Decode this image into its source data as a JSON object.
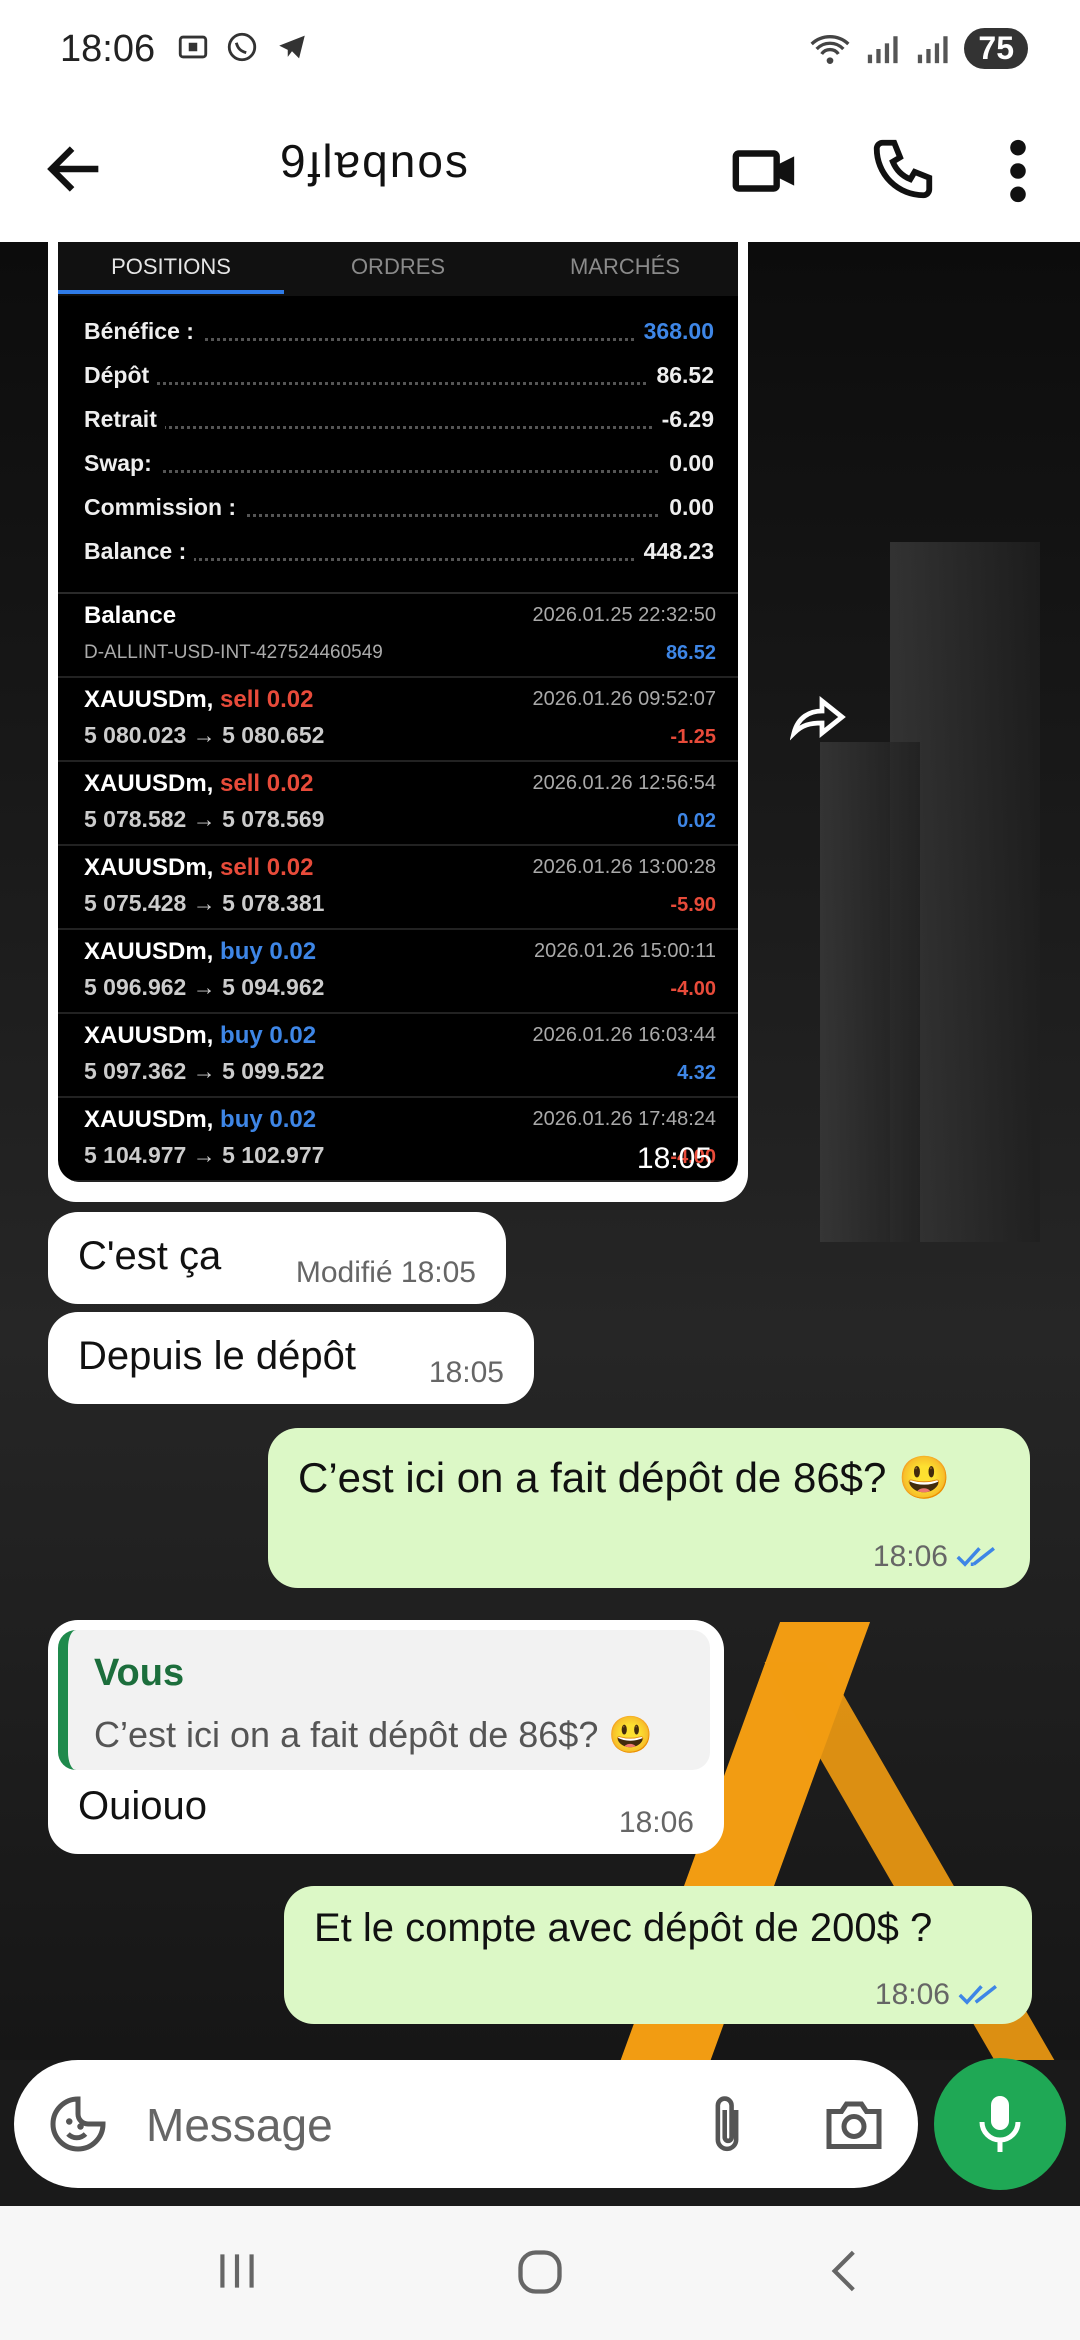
{
  "status_bar": {
    "time": "18:06",
    "battery": "75",
    "icons": [
      "screenshot-icon",
      "whatsapp-icon",
      "telegram-icon",
      "wifi-icon",
      "signal-icon"
    ]
  },
  "header": {
    "contact_name": "9ɟlɐqnos",
    "icons": [
      "back-arrow-icon",
      "video-call-icon",
      "phone-call-icon",
      "more-vert-icon"
    ]
  },
  "image_message": {
    "tabs": [
      "POSITIONS",
      "ORDRES",
      "MARCHÉS"
    ],
    "summary": [
      {
        "label": "Bénéfice :",
        "value": "368.00",
        "color": "#3e86e6"
      },
      {
        "label": "Dépôt",
        "value": "86.52",
        "color": "#eeeeee"
      },
      {
        "label": "Retrait",
        "value": "-6.29",
        "color": "#eeeeee"
      },
      {
        "label": "Swap:",
        "value": "0.00",
        "color": "#eeeeee"
      },
      {
        "label": "Commission :",
        "value": "0.00",
        "color": "#eeeeee"
      },
      {
        "label": "Balance :",
        "value": "448.23",
        "color": "#eeeeee"
      }
    ],
    "balance_entry": {
      "title": "Balance",
      "account": "D-ALLINT-USD-INT-427524460549",
      "datetime": "2026.01.25 22:32:50",
      "amount": "86.52"
    },
    "trades": [
      {
        "symbol": "XAUUSDm,",
        "side": "sell 0.02",
        "prices": "5 080.023 → 5 080.652",
        "datetime": "2026.01.26 09:52:07",
        "profit": "-1.25"
      },
      {
        "symbol": "XAUUSDm,",
        "side": "sell 0.02",
        "prices": "5 078.582 → 5 078.569",
        "datetime": "2026.01.26 12:56:54",
        "profit": "0.02"
      },
      {
        "symbol": "XAUUSDm,",
        "side": "sell 0.02",
        "prices": "5 075.428 → 5 078.381",
        "datetime": "2026.01.26 13:00:28",
        "profit": "-5.90"
      },
      {
        "symbol": "XAUUSDm,",
        "side": "buy 0.02",
        "prices": "5 096.962 → 5 094.962",
        "datetime": "2026.01.26 15:00:11",
        "profit": "-4.00"
      },
      {
        "symbol": "XAUUSDm,",
        "side": "buy 0.02",
        "prices": "5 097.362 → 5 099.522",
        "datetime": "2026.01.26 16:03:44",
        "profit": "4.32"
      },
      {
        "symbol": "XAUUSDm,",
        "side": "buy 0.02",
        "prices": "5 104.977 → 5 102.977",
        "datetime": "2026.01.26 17:48:24",
        "profit": "-4.00"
      }
    ],
    "time": "18:05"
  },
  "messages": [
    {
      "text": "C'est ça",
      "meta": "Modifié 18:05"
    },
    {
      "text": "Depuis le dépôt",
      "meta": "18:05"
    },
    {
      "text": "C’est ici on a fait dépôt de 86$? 😃",
      "meta": "18:06"
    },
    {
      "quote_name": "Vous",
      "quote_text": "C’est ici on a fait dépôt de 86$? 😃",
      "text": "Ouiouo",
      "meta": "18:06"
    },
    {
      "text": "Et le compte avec dépôt de 200$ ?",
      "meta": "18:06"
    }
  ],
  "composer": {
    "placeholder": "Message"
  },
  "colors": {
    "outgoing_bubble": "#dcf8c6",
    "send_button": "#1fa855",
    "read_ticks": "#3e86e6"
  }
}
